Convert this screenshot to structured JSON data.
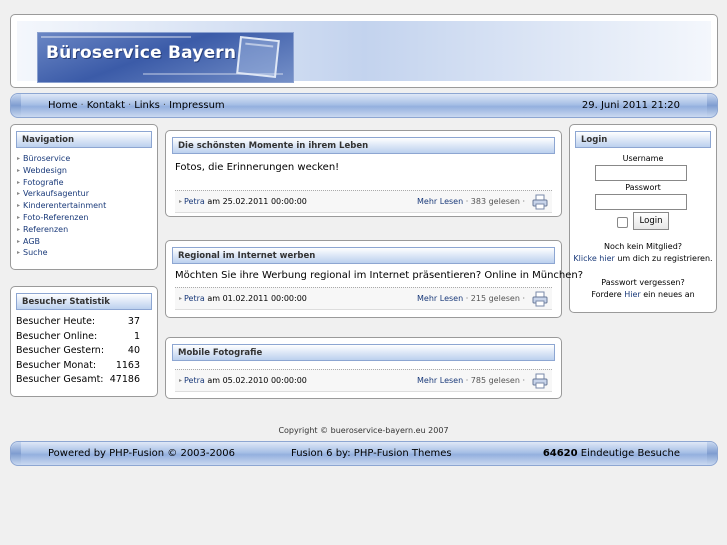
{
  "header": {
    "logo_text": "Büroservice Bayern"
  },
  "topbar": {
    "menu": [
      "Home",
      "Kontakt",
      "Links",
      "Impressum"
    ],
    "datetime": "29. Juni 2011 21:20"
  },
  "navigation": {
    "title": "Navigation",
    "items": [
      "Büroservice",
      "Webdesign",
      "Fotografie",
      "Verkaufsagentur",
      "Kinderentertainment",
      "Foto-Referenzen",
      "Referenzen",
      "AGB",
      "Suche"
    ]
  },
  "stats": {
    "title": "Besucher Statistik",
    "rows": [
      {
        "label": "Besucher Heute:",
        "value": "37"
      },
      {
        "label": "Besucher Online:",
        "value": "1"
      },
      {
        "label": "Besucher Gestern:",
        "value": "40"
      },
      {
        "label": "Besucher Monat:",
        "value": "1163"
      },
      {
        "label": "Besucher Gesamt:",
        "value": "47186"
      }
    ]
  },
  "login": {
    "title": "Login",
    "username_label": "Username",
    "password_label": "Passwort",
    "button_label": "Login",
    "no_member": "Noch kein Mitglied?",
    "click_here": "Klicke hier",
    "register_suffix": " um dich zu registrieren.",
    "forgot": "Passwort vergessen?",
    "request_prefix": "Fordere ",
    "request_link": "Hier",
    "request_suffix": " ein neues an"
  },
  "news": [
    {
      "title": "Die schönsten Momente in ihrem Leben",
      "body": "Fotos, die Erinnerungen wecken!",
      "author": "Petra",
      "date_text": " am 25.02.2011 00:00:00",
      "read_more": "Mehr Lesen",
      "reads": " · 383 gelesen · "
    },
    {
      "title": "Regional im Internet werben",
      "body": "Möchten Sie ihre Werbung regional im Internet präsentieren? Online in München?",
      "author": "Petra",
      "date_text": " am 01.02.2011 00:00:00",
      "read_more": "Mehr Lesen",
      "reads": " · 215 gelesen · "
    },
    {
      "title": "Mobile Fotografie",
      "body": "",
      "author": "Petra",
      "date_text": " am 05.02.2010 00:00:00",
      "read_more": "Mehr Lesen",
      "reads": " · 785 gelesen · "
    }
  ],
  "copyright": "Copyright © bueroservice-bayern.eu 2007",
  "footer": {
    "powered": "Powered by PHP-Fusion © 2003-2006",
    "theme": "Fusion 6 by: PHP-Fusion Themes",
    "visits_count": "64620",
    "visits_label": " Eindeutige Besuche"
  },
  "colors": {
    "accent": "#1a3a7a",
    "bar_blue": "#a8c0e6",
    "logo_blue": "#3b5ba8"
  }
}
